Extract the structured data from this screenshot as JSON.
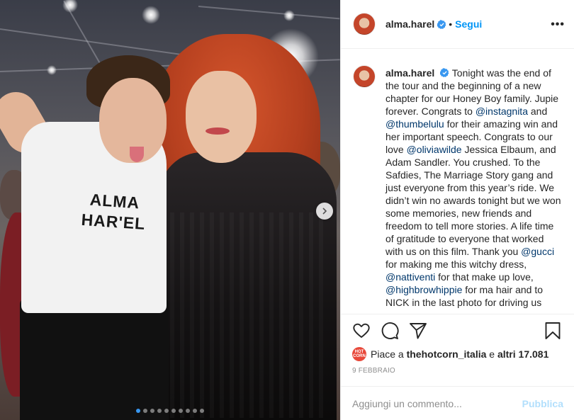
{
  "post": {
    "username": "alma.harel",
    "follow_label": "Segui",
    "more_label": "•••",
    "photo": {
      "shirt_text_line1": "ALMA",
      "shirt_text_line2": "HAR'EL",
      "carousel_count": 10,
      "carousel_active": 0
    },
    "caption": {
      "username": "alma.harel",
      "parts": [
        {
          "t": "text",
          "v": " Tonight was the end of the tour and the beginning of a new chapter for our Honey Boy family. Jupie forever. Congrats to "
        },
        {
          "t": "mention",
          "v": "@instagnita"
        },
        {
          "t": "text",
          "v": " and "
        },
        {
          "t": "mention",
          "v": "@thumbelulu"
        },
        {
          "t": "text",
          "v": " for their amazing win and her important speech. Congrats to our love "
        },
        {
          "t": "mention",
          "v": "@oliviawilde"
        },
        {
          "t": "text",
          "v": " Jessica Elbaum, and Adam Sandler. You crushed. To the Safdies, The Marriage Story gang and just everyone from this year’s ride. We didn’t win no awards tonight but we won some memories, new friends and freedom to tell more stories. A life time of gratitude to everyone that worked with us on this film. Thank you "
        },
        {
          "t": "mention",
          "v": "@gucci"
        },
        {
          "t": "text",
          "v": " for making me this witchy dress, "
        },
        {
          "t": "mention",
          "v": "@nattiventi"
        },
        {
          "t": "text",
          "v": " for that make up love, "
        },
        {
          "t": "mention",
          "v": "@highbrowhippie"
        },
        {
          "t": "text",
          "v": " for ma hair and to NICK in the last photo for driving us"
        }
      ]
    },
    "likes": {
      "prefix": "Piace a ",
      "user": "thehotcorn_italia",
      "middle": " e ",
      "count": "altri 17.081",
      "avatar_text": "HOT CORN"
    },
    "date": "9 FEBBRAIO",
    "comment_placeholder": "Aggiungi un commento...",
    "publish_label": "Pubblica"
  },
  "colors": {
    "accent": "#0095f6",
    "mention": "#00376b",
    "muted": "#8e8e8e",
    "publish_disabled": "#b2dffc"
  }
}
